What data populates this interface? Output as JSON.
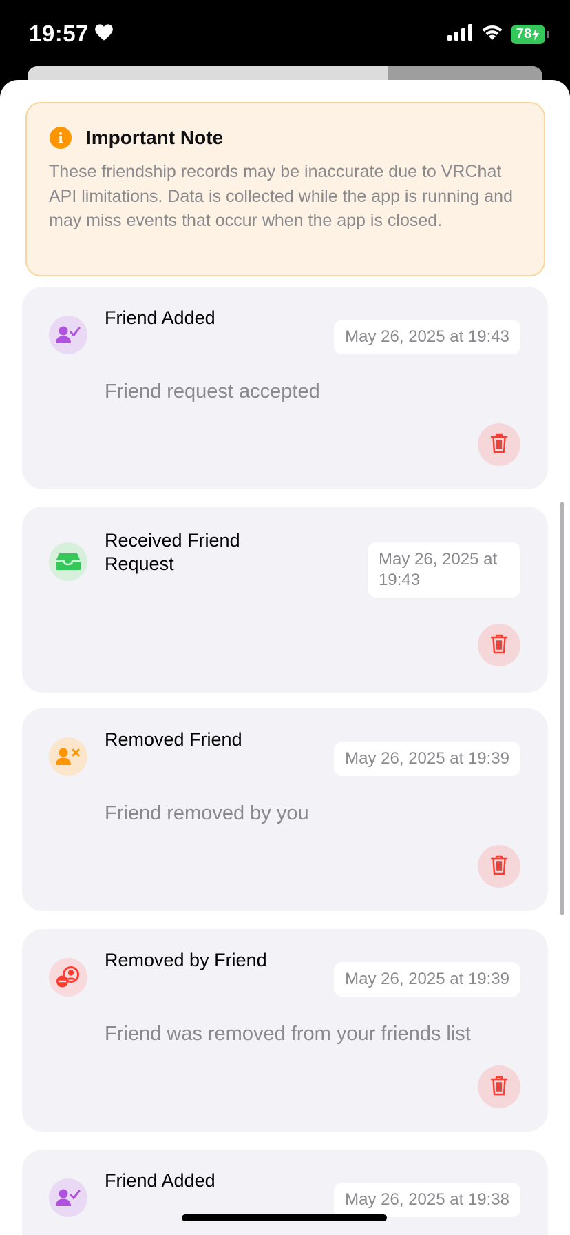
{
  "status_bar": {
    "time": "19:57",
    "battery": "78"
  },
  "note": {
    "title": "Important Note",
    "body": "These friendship records may be inaccurate due to VRChat API limitations. Data is collected while the app is running and may miss events that occur when the app is closed."
  },
  "events": [
    {
      "type": "friend-added",
      "title": "Friend Added",
      "date": "May 26, 2025 at 19:43",
      "description": "Friend request accepted",
      "icon": "person-check-icon",
      "color": "#af52de"
    },
    {
      "type": "received-request",
      "title": "Received Friend Request",
      "date": "May 26, 2025 at 19:43",
      "description": "",
      "icon": "tray-icon",
      "color": "#34c759"
    },
    {
      "type": "removed-friend",
      "title": "Removed Friend",
      "date": "May 26, 2025 at 19:39",
      "description": "Friend removed by you",
      "icon": "person-x-icon",
      "color": "#ff9500"
    },
    {
      "type": "removed-by-friend",
      "title": "Removed by Friend",
      "date": "May 26, 2025 at 19:39",
      "description": "Friend was removed from your friends list",
      "icon": "person-remove-icon",
      "color": "#ff3b30"
    },
    {
      "type": "friend-added",
      "title": "Friend Added",
      "date": "May 26, 2025 at 19:38",
      "description": "",
      "icon": "person-check-icon",
      "color": "#af52de"
    }
  ],
  "colors": {
    "delete": "#ff3b30",
    "note_accent": "#ff9500"
  }
}
